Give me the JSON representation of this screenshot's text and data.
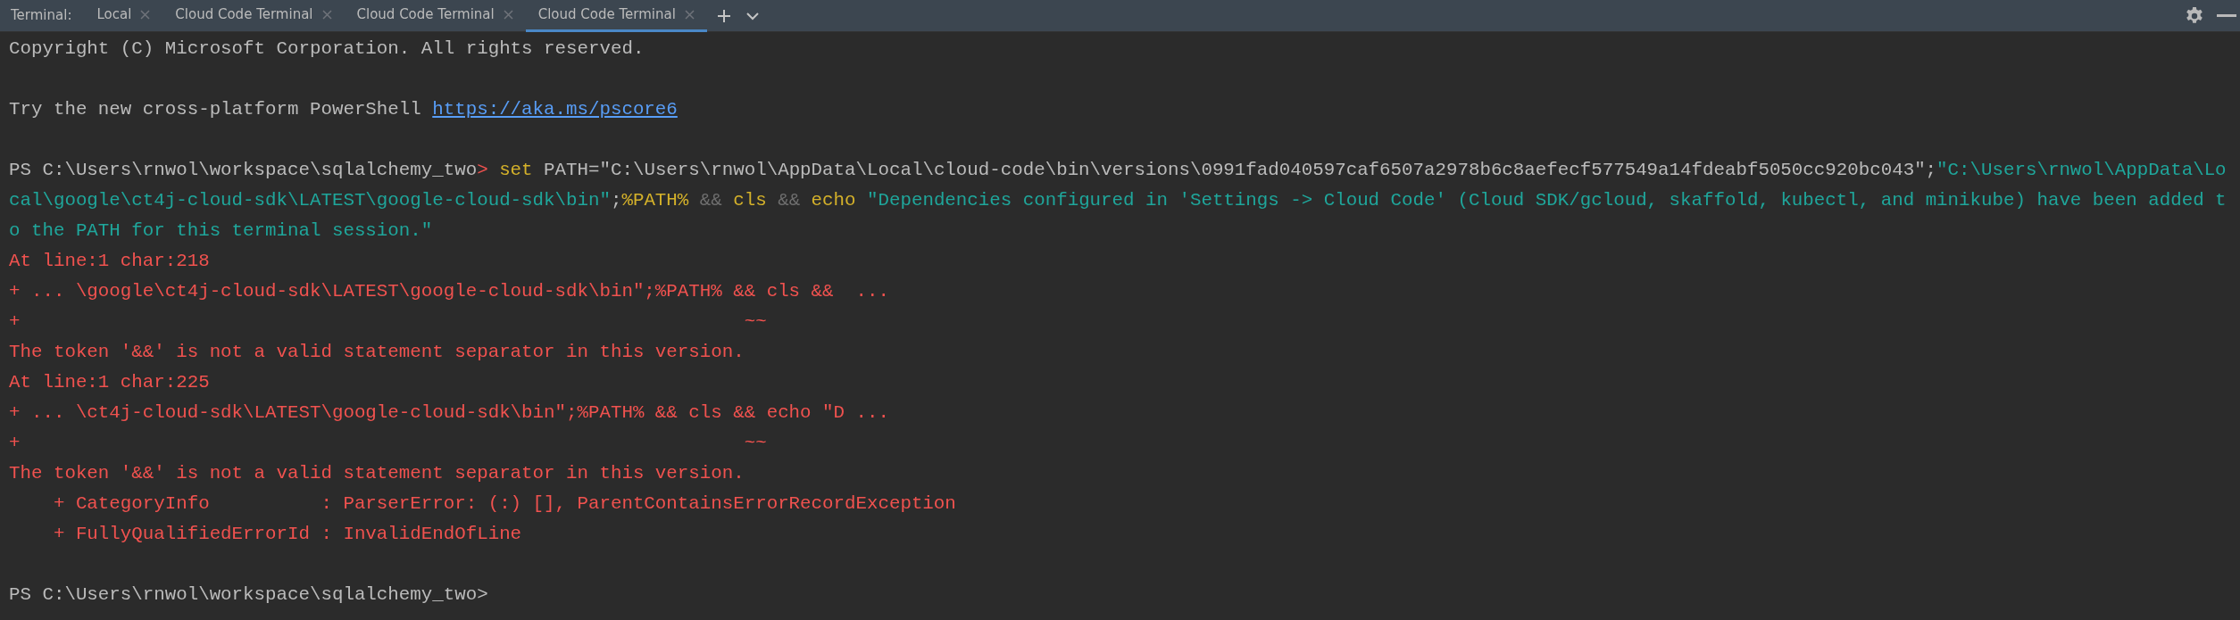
{
  "tab_bar": {
    "label": "Terminal:",
    "tabs": [
      {
        "label": "Local",
        "selected": false
      },
      {
        "label": "Cloud Code Terminal",
        "selected": false
      },
      {
        "label": "Cloud Code Terminal",
        "selected": false
      },
      {
        "label": "Cloud Code Terminal",
        "selected": true
      }
    ]
  },
  "terminal": {
    "lines": [
      {
        "kind": "text",
        "segments": [
          {
            "text": "Copyright (C) Microsoft Corporation. All rights reserved.",
            "kind": "plain"
          }
        ]
      },
      {
        "kind": "blank"
      },
      {
        "kind": "text",
        "segments": [
          {
            "text": "Try the new cross-platform PowerShell ",
            "kind": "plain"
          },
          {
            "text": "https://aka.ms/pscore6",
            "kind": "link"
          }
        ]
      },
      {
        "kind": "blank"
      },
      {
        "kind": "text",
        "segments": [
          {
            "text": "PS C:\\Users\\rnwol\\workspace\\sqlalchemy_two",
            "kind": "plain"
          },
          {
            "text": "> ",
            "kind": "prompt"
          },
          {
            "text": "set",
            "kind": "keyword"
          },
          {
            "text": " PATH=\"C:\\Users\\rnwol\\AppData\\Local\\cloud-code\\bin\\versions\\0991fad040597caf6507a2978b6c8aefecf577549a14fdeabf5050cc920bc043\";",
            "kind": "plain"
          },
          {
            "text": "\"C:\\Users\\rnwol\\AppData\\Lo",
            "kind": "string"
          }
        ]
      },
      {
        "kind": "text",
        "segments": [
          {
            "text": "cal\\google\\ct4j-cloud-sdk\\LATEST\\google-cloud-sdk\\bin\"",
            "kind": "string"
          },
          {
            "text": ";",
            "kind": "plain"
          },
          {
            "text": "%PATH%",
            "kind": "keyword"
          },
          {
            "text": " && ",
            "kind": "operator"
          },
          {
            "text": "cls",
            "kind": "keyword"
          },
          {
            "text": " && ",
            "kind": "operator"
          },
          {
            "text": "echo",
            "kind": "keyword"
          },
          {
            "text": " \"Dependencies configured in 'Settings -> Cloud Code' (Cloud SDK/gcloud, skaffold, kubectl, and minikube) have been added t",
            "kind": "string"
          }
        ]
      },
      {
        "kind": "text",
        "segments": [
          {
            "text": "o the PATH for this terminal session.\"",
            "kind": "string"
          }
        ]
      },
      {
        "kind": "text",
        "segments": [
          {
            "text": "At line:1 char:218",
            "kind": "error"
          }
        ]
      },
      {
        "kind": "text",
        "segments": [
          {
            "text": "+ ... \\google\\ct4j-cloud-sdk\\LATEST\\google-cloud-sdk\\bin\";%PATH% && cls &&  ...",
            "kind": "error"
          }
        ]
      },
      {
        "kind": "text",
        "segments": [
          {
            "text": "+                                                                 ~~",
            "kind": "error"
          }
        ]
      },
      {
        "kind": "text",
        "segments": [
          {
            "text": "The token '&&' is not a valid statement separator in this version.",
            "kind": "error"
          }
        ]
      },
      {
        "kind": "text",
        "segments": [
          {
            "text": "At line:1 char:225",
            "kind": "error"
          }
        ]
      },
      {
        "kind": "text",
        "segments": [
          {
            "text": "+ ... \\ct4j-cloud-sdk\\LATEST\\google-cloud-sdk\\bin\";%PATH% && cls && echo \"D ...",
            "kind": "error"
          }
        ]
      },
      {
        "kind": "text",
        "segments": [
          {
            "text": "+                                                                 ~~",
            "kind": "error"
          }
        ]
      },
      {
        "kind": "text",
        "segments": [
          {
            "text": "The token '&&' is not a valid statement separator in this version.",
            "kind": "error"
          }
        ]
      },
      {
        "kind": "text",
        "segments": [
          {
            "text": "    + CategoryInfo          : ParserError: (:) [], ParentContainsErrorRecordException",
            "kind": "error"
          }
        ]
      },
      {
        "kind": "text",
        "segments": [
          {
            "text": "    + FullyQualifiedErrorId : InvalidEndOfLine",
            "kind": "error"
          }
        ]
      },
      {
        "kind": "blank"
      },
      {
        "kind": "text",
        "segments": [
          {
            "text": "PS C:\\Users\\rnwol\\workspace\\sqlalchemy_two>",
            "kind": "plain"
          }
        ]
      }
    ]
  }
}
